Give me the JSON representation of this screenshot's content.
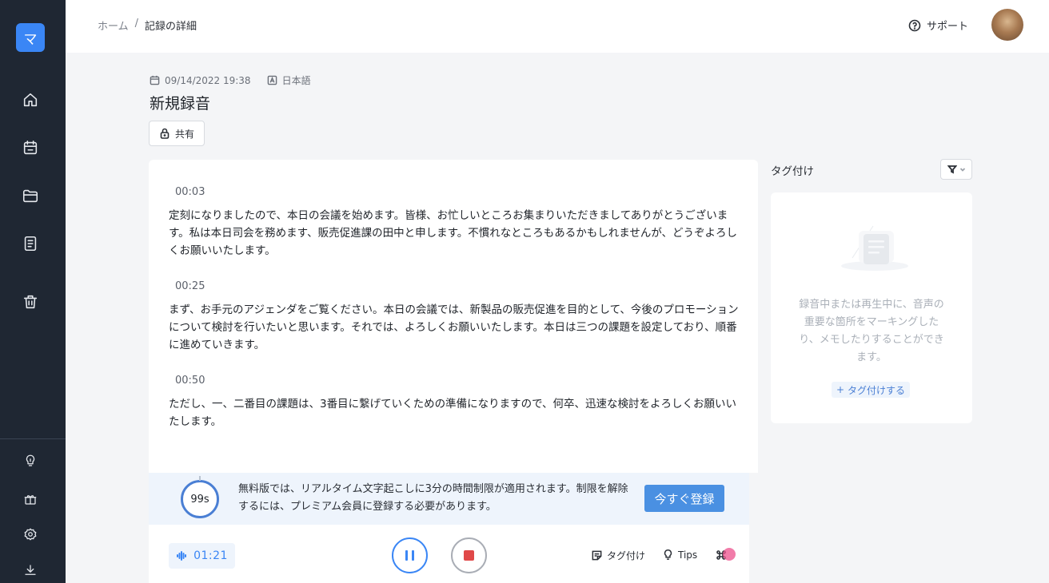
{
  "sidebar": {
    "logo": "マ",
    "items": [
      {
        "name": "home-icon"
      },
      {
        "name": "calendar-icon"
      },
      {
        "name": "folder-icon"
      },
      {
        "name": "document-icon"
      },
      {
        "name": "trash-icon"
      }
    ],
    "bottom_items": [
      {
        "name": "lightbulb-icon"
      },
      {
        "name": "gift-icon"
      },
      {
        "name": "settings-icon"
      },
      {
        "name": "download-icon"
      }
    ]
  },
  "header": {
    "breadcrumb": {
      "home": "ホーム",
      "separator": "/",
      "current": "記録の詳細"
    },
    "support_label": "サポート"
  },
  "record": {
    "datetime": "09/14/2022 19:38",
    "language": "日本語",
    "title": "新規録音",
    "share_label": "共有"
  },
  "transcript": [
    {
      "time": "00:03",
      "text": "定刻になりましたので、本日の会議を始めます。皆様、お忙しいところお集まりいただきましてありがとうございます。私は本日司会を務めます、販売促進課の田中と申します。不慣れなところもあるかもしれませんが、どうぞよろしくお願いいたします。"
    },
    {
      "time": "00:25",
      "text": "まず、お手元のアジェンダをご覧ください。本日の会議では、新製品の販売促進を目的として、今後のプロモーションについて検討を行いたいと思います。それでは、よろしくお願いいたします。本日は三つの課題を設定しており、順番に進めていきます。"
    },
    {
      "time": "00:50",
      "text": "ただし、一、二番目の課題は、3番目に繋げていくための準備になりますので、何卒、迅速な検討をよろしくお願いいたします。"
    }
  ],
  "notice": {
    "timer": "99s",
    "text": "無料版では、リアルタイム文字起こしに3分の時間制限が適用されます。制限を解除するには、プレミアム会員に登録する必要があります。",
    "register_label": "今すぐ登録"
  },
  "player": {
    "elapsed": "01:21",
    "tag_label": "タグ付け",
    "tips_label": "Tips"
  },
  "tag_panel": {
    "title": "タグ付け",
    "empty_text": "録音中または再生中に、音声の重要な箇所をマーキングしたり、メモしたりすることができます。",
    "add_label": "タグ付けする",
    "add_prefix": "+"
  },
  "colors": {
    "sidebar": "#1f2733",
    "accent": "#3a86f5",
    "register_button": "#4a90e2",
    "stop": "#e04848"
  }
}
